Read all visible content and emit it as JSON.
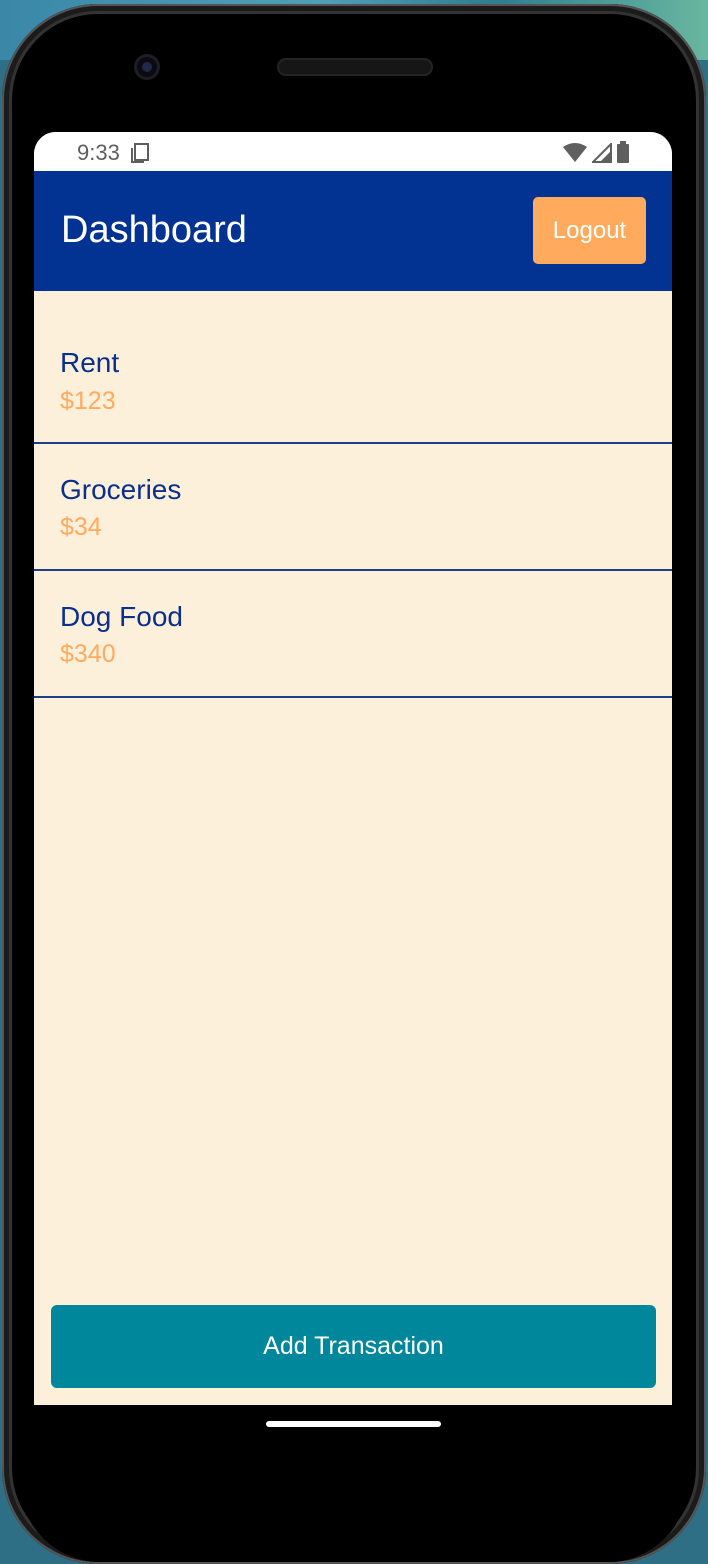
{
  "status_bar": {
    "time": "9:33",
    "icons": [
      "sim-card-icon",
      "wifi-icon",
      "signal-icon",
      "battery-icon"
    ]
  },
  "header": {
    "title": "Dashboard",
    "logout_label": "Logout"
  },
  "transactions": [
    {
      "name": "Rent",
      "amount": "$123"
    },
    {
      "name": "Groceries",
      "amount": "$34"
    },
    {
      "name": "Dog Food",
      "amount": "$340"
    }
  ],
  "actions": {
    "add_transaction_label": "Add Transaction"
  },
  "colors": {
    "header_bg": "#023292",
    "accent_orange": "#ffaa5c",
    "screen_bg": "#fdf0db",
    "primary_button": "#00879c",
    "text_blue": "#0b2f8a"
  }
}
